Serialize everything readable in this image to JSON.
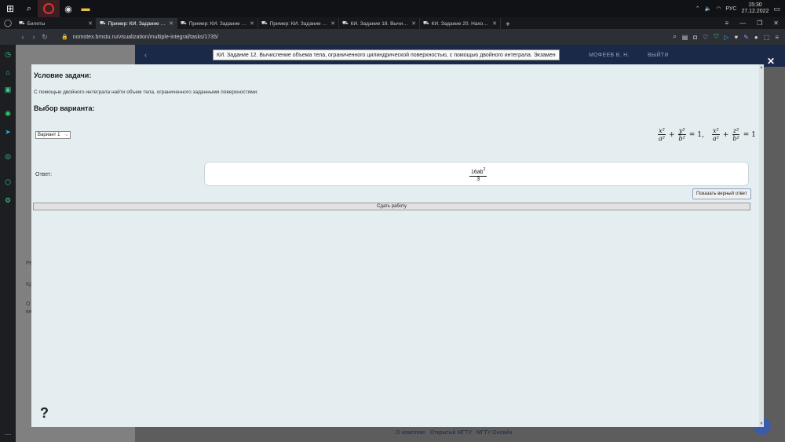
{
  "taskbar": {
    "clock_time": "15:30",
    "clock_date": "27.12.2022",
    "lang": "РУС"
  },
  "tabs": [
    {
      "title": "Билеты",
      "active": false
    },
    {
      "title": "Пример: КИ. Задание 12.",
      "active": true
    },
    {
      "title": "Пример: КИ. Задание 16.",
      "active": false
    },
    {
      "title": "Пример: КИ. Задание 17.",
      "active": false
    },
    {
      "title": "КИ. Задание 18. Вычислени",
      "active": false
    },
    {
      "title": "КИ. Задание 20. Нахожден",
      "active": false
    }
  ],
  "address": {
    "url": "nomotex.bmstu.ru/visualization/multiple-integral/tasks/1735/"
  },
  "page_bg": {
    "header_name": "МОФЕЕВ В. Н.",
    "header_logout": "ВЫЙТИ",
    "frag_re": "Ре",
    "frag_kr": "Кр",
    "frag_o": "О",
    "frag_v": "ве",
    "footer_links": [
      "О номотеке",
      "Открытый МГТУ",
      "МГТУ Онлайн"
    ]
  },
  "tooltip": {
    "text": "КИ. Задание 12. Вычисление объема тела, ограниченного цилиндрической поверхностью, с помощью двойного интеграла. Экзамен"
  },
  "modal": {
    "condition_title": "Условие задачи:",
    "condition_text": "С помощью двойного интеграла найти объем тела, ограниченного заданными поверхностями.",
    "variant_title": "Выбор варианта:",
    "variant_selected": "Вариант 1",
    "answer_label": "Ответ:",
    "answer_num": "16ab",
    "answer_exp": "2",
    "answer_den": "3",
    "show_answer_label": "Показать верный ответ",
    "submit_label": "Сдать работу",
    "help_label": "?",
    "close_label": "✕"
  },
  "formula": {
    "t1_num": "x²",
    "t1_den": "a²",
    "op1": "+",
    "t2_num": "y²",
    "t2_den": "b²",
    "eq1": "= 1,",
    "t3_num": "x²",
    "t3_den": "a²",
    "op2": "+",
    "t4_num": "z²",
    "t4_den": "b²",
    "eq2": "= 1"
  },
  "colors": {
    "modal_bg": "#e4eef1",
    "page_header": "#1a2948",
    "accent": "#3b5ba9"
  }
}
